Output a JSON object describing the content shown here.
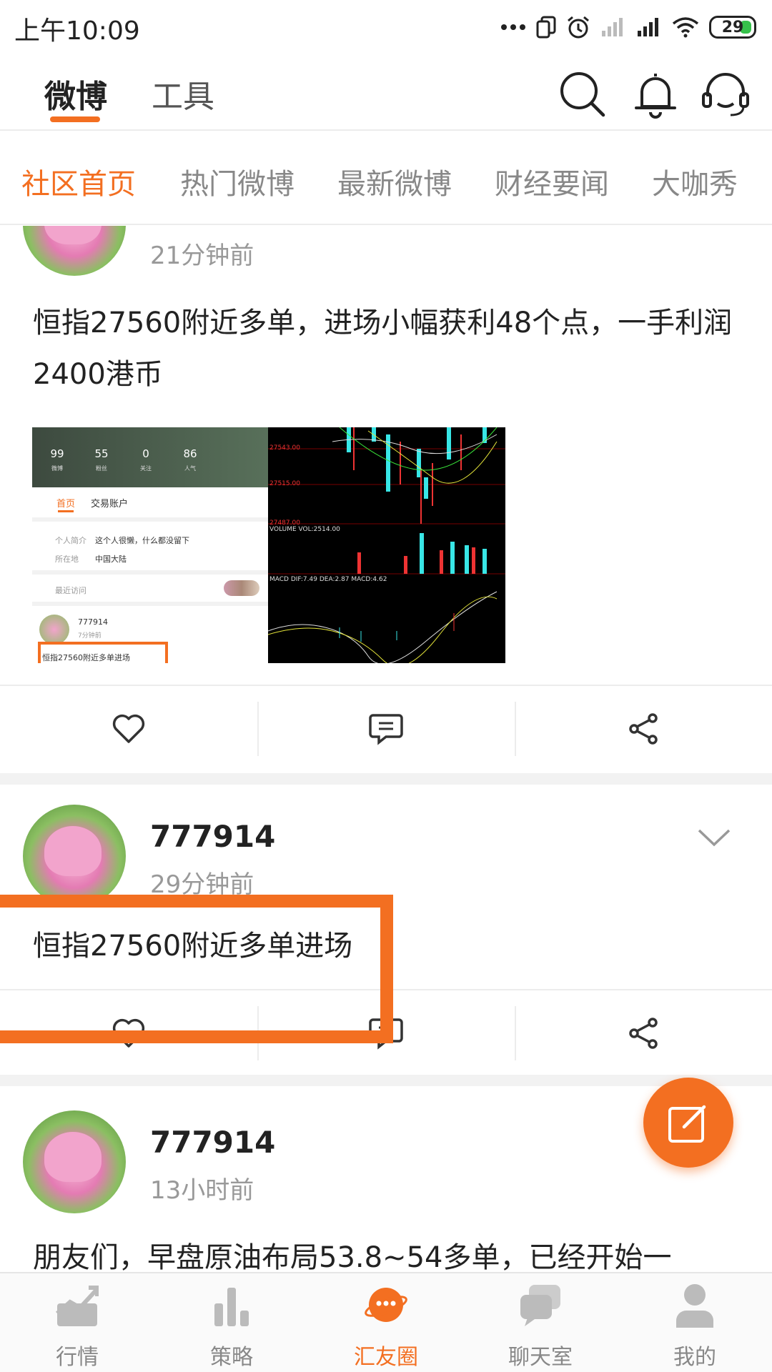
{
  "status_bar": {
    "time": "上午10:09",
    "battery": "29",
    "icons": [
      "more-dots-icon",
      "dual-sim-icon",
      "alarm-icon",
      "signal-weak-icon",
      "signal-icon",
      "wifi-icon",
      "battery-icon"
    ]
  },
  "top_nav": {
    "tabs": [
      {
        "label": "微博",
        "active": true
      },
      {
        "label": "工具",
        "active": false
      }
    ],
    "icons": [
      "search-icon",
      "bell-icon",
      "headset-icon"
    ]
  },
  "category_tabs": [
    {
      "label": "社区首页",
      "active": true
    },
    {
      "label": "热门微博",
      "active": false
    },
    {
      "label": "最新微博",
      "active": false
    },
    {
      "label": "财经要闻",
      "active": false
    },
    {
      "label": "大咖秀",
      "active": false
    }
  ],
  "posts": [
    {
      "time_ago": "21分钟前",
      "text": "恒指27560附近多单，进场小幅获利48个点，一手利润2400港币",
      "image": {
        "stats": [
          {
            "value": "99",
            "label": "微博"
          },
          {
            "value": "55",
            "label": "粉丝"
          },
          {
            "value": "0",
            "label": "关注"
          },
          {
            "value": "86",
            "label": "人气"
          }
        ],
        "tabs": [
          "首页",
          "交易账户"
        ],
        "intro_label": "个人简介",
        "intro_value": "这个人很懒，什么都没留下",
        "location_label": "所在地",
        "location_value": "中国大陆",
        "visitors_label": "最近访问",
        "mini_user": "777914",
        "mini_time": "7分钟前",
        "mini_text": "恒指27560附近多单进场",
        "chart_labels": {
          "price1": "27543.00",
          "price2": "27515.00",
          "price3": "27487.00",
          "volume": "VOLUME VOL:2514.00",
          "macd": "MACD DIF:7.49 DEA:2.87 MACD:4.62"
        }
      },
      "actions": [
        "like-icon",
        "comment-icon",
        "share-icon"
      ]
    },
    {
      "username": "777914",
      "time_ago": "29分钟前",
      "text": "恒指27560附近多单进场",
      "actions": [
        "like-icon",
        "comment-icon",
        "share-icon"
      ]
    },
    {
      "username": "777914",
      "time_ago": "13小时前",
      "text": "朋友们，早盘原油布局53.8~54多单，已经开始一"
    }
  ],
  "bottom_nav": [
    {
      "label": "行情",
      "icon": "chart-line-icon",
      "active": false
    },
    {
      "label": "策略",
      "icon": "bar-chart-icon",
      "active": false
    },
    {
      "label": "汇友圈",
      "icon": "planet-chat-icon",
      "active": true
    },
    {
      "label": "聊天室",
      "icon": "chat-bubbles-icon",
      "active": false
    },
    {
      "label": "我的",
      "icon": "user-icon",
      "active": false
    }
  ],
  "colors": {
    "accent": "#f36f21",
    "text": "#222222",
    "muted": "#999999",
    "divider": "#ececec"
  }
}
